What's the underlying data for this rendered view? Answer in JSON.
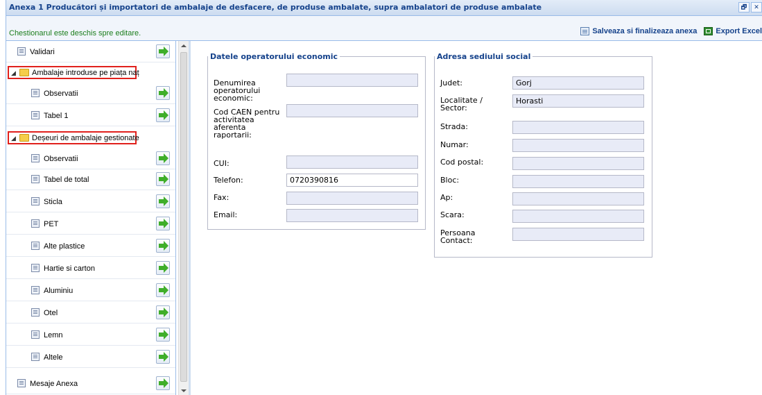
{
  "window": {
    "title": "Anexa 1 Producători și importatori de ambalaje de desfacere, de produse ambalate, supra ambalatori de produse ambalate",
    "restore_glyph": "🗗",
    "close_glyph": "✕"
  },
  "toolbar": {
    "status": "Chestionarul este deschis spre editare.",
    "save_label": "Salveaza si finalizeaza anexa",
    "export_label": "Export Excel"
  },
  "tree": {
    "items": [
      {
        "label": "Validari",
        "type": "doc"
      },
      {
        "label": "Ambalaje introduse pe piața naț",
        "type": "folder"
      },
      {
        "label": "Observatii",
        "type": "doc"
      },
      {
        "label": "Tabel 1",
        "type": "doc"
      },
      {
        "label": "Deșeuri de ambalaje gestionate",
        "type": "folder"
      },
      {
        "label": "Observatii",
        "type": "doc"
      },
      {
        "label": "Tabel de total",
        "type": "doc"
      },
      {
        "label": "Sticla",
        "type": "doc"
      },
      {
        "label": "PET",
        "type": "doc"
      },
      {
        "label": "Alte plastice",
        "type": "doc"
      },
      {
        "label": "Hartie si carton",
        "type": "doc"
      },
      {
        "label": "Aluminiu",
        "type": "doc"
      },
      {
        "label": "Otel",
        "type": "doc"
      },
      {
        "label": "Lemn",
        "type": "doc"
      },
      {
        "label": "Altele",
        "type": "doc"
      },
      {
        "label": "Mesaje Anexa",
        "type": "doc"
      }
    ]
  },
  "operator": {
    "legend": "Datele operatorului economic",
    "fields": [
      {
        "label": "Denumirea\noperatorului\neconomic:",
        "value": ""
      },
      {
        "label": "Cod CAEN pentru\nactivitatea\naferenta\nraportarii:",
        "value": ""
      },
      {
        "label": "CUI:",
        "value": ""
      },
      {
        "label": "Telefon:",
        "value": "0720390816"
      },
      {
        "label": "Fax:",
        "value": ""
      },
      {
        "label": "Email:",
        "value": ""
      }
    ]
  },
  "address": {
    "legend": "Adresa sediului social",
    "fields": [
      {
        "label": "Judet:",
        "value": "Gorj"
      },
      {
        "label": "Localitate /\nSector:",
        "value": "Horasti"
      },
      {
        "label": "Strada:",
        "value": ""
      },
      {
        "label": "Numar:",
        "value": ""
      },
      {
        "label": "Cod postal:",
        "value": ""
      },
      {
        "label": "Bloc:",
        "value": ""
      },
      {
        "label": "Ap:",
        "value": ""
      },
      {
        "label": "Scara:",
        "value": ""
      },
      {
        "label": "Persoana\nContact:",
        "value": ""
      }
    ]
  }
}
